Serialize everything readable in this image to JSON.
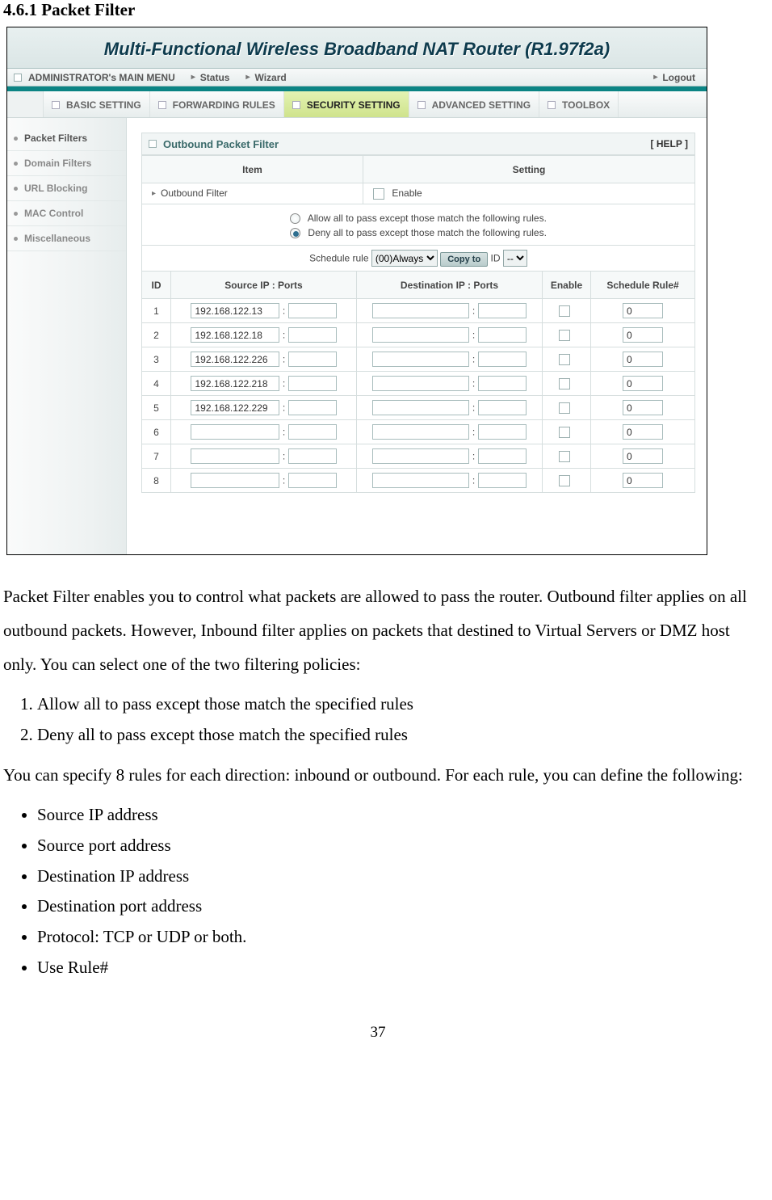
{
  "doc": {
    "section_heading": "4.6.1 Packet Filter",
    "para1": "Packet Filter enables you to control what packets are allowed to pass the router. Outbound filter applies on all outbound packets. However, Inbound filter applies on packets that destined to Virtual Servers or DMZ host only. You can select one of the two filtering policies:",
    "list1": [
      "Allow all to pass except those match the specified rules",
      "Deny all to pass except those match the specified rules"
    ],
    "para2": "You can specify 8 rules for each direction: inbound or outbound. For each rule, you can define the following:",
    "list2": [
      "Source IP address",
      "Source port address",
      "Destination IP address",
      "Destination port address",
      "Protocol: TCP or UDP or both.",
      "Use Rule#"
    ],
    "page_num": "37"
  },
  "router": {
    "title": "Multi-Functional Wireless Broadband NAT Router (R1.97f2a)",
    "admin_bar": {
      "menu": "ADMINISTRATOR's MAIN MENU",
      "links": [
        "Status",
        "Wizard"
      ],
      "logout": "Logout"
    },
    "tabs": [
      "BASIC SETTING",
      "FORWARDING RULES",
      "SECURITY SETTING",
      "ADVANCED SETTING",
      "TOOLBOX"
    ],
    "active_tab": 2,
    "sidebar": [
      "Packet Filters",
      "Domain Filters",
      "URL Blocking",
      "MAC Control",
      "Miscellaneous"
    ],
    "active_sidebar": 0,
    "panel": {
      "title": "Outbound Packet Filter",
      "help": "[ HELP ]",
      "col_item": "Item",
      "col_setting": "Setting",
      "outbound_label": "Outbound Filter",
      "enable_label": "Enable",
      "radio_allow": "Allow all to pass except those match the following rules.",
      "radio_deny": "Deny all to pass except those match the following rules.",
      "schedule_label": "Schedule rule",
      "schedule_sel": "(00)Always",
      "copy_btn": "Copy to",
      "id_label": "ID",
      "id_sel": "--",
      "th_id": "ID",
      "th_src": "Source IP : Ports",
      "th_dst": "Destination IP : Ports",
      "th_enable": "Enable",
      "th_rule": "Schedule Rule#",
      "rows": [
        {
          "id": "1",
          "src_ip": "192.168.122.13",
          "src_port": "",
          "dst_ip": "",
          "dst_port": "",
          "rule": "0"
        },
        {
          "id": "2",
          "src_ip": "192.168.122.18",
          "src_port": "",
          "dst_ip": "",
          "dst_port": "",
          "rule": "0"
        },
        {
          "id": "3",
          "src_ip": "192.168.122.226",
          "src_port": "",
          "dst_ip": "",
          "dst_port": "",
          "rule": "0"
        },
        {
          "id": "4",
          "src_ip": "192.168.122.218",
          "src_port": "",
          "dst_ip": "",
          "dst_port": "",
          "rule": "0"
        },
        {
          "id": "5",
          "src_ip": "192.168.122.229",
          "src_port": "",
          "dst_ip": "",
          "dst_port": "",
          "rule": "0"
        },
        {
          "id": "6",
          "src_ip": "",
          "src_port": "",
          "dst_ip": "",
          "dst_port": "",
          "rule": "0"
        },
        {
          "id": "7",
          "src_ip": "",
          "src_port": "",
          "dst_ip": "",
          "dst_port": "",
          "rule": "0"
        },
        {
          "id": "8",
          "src_ip": "",
          "src_port": "",
          "dst_ip": "",
          "dst_port": "",
          "rule": "0"
        }
      ]
    }
  }
}
